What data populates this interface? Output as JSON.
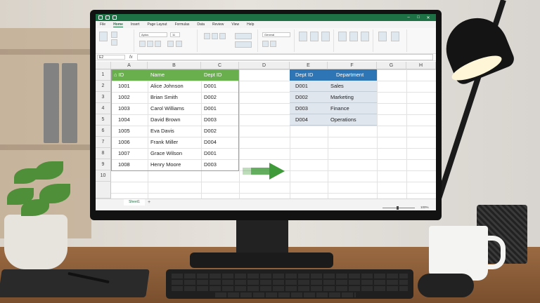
{
  "app": {
    "title": "",
    "menu": [
      "File",
      "Home",
      "Insert",
      "Page Layout",
      "Formulas",
      "Data",
      "Review",
      "View",
      "Help"
    ],
    "active_menu": "Home",
    "name_box": "E2",
    "fx": "fx",
    "font_name": "Aptos",
    "font_size": "11",
    "number_format": "General",
    "sheet_tab": "Sheet1",
    "zoom": "100%"
  },
  "columns": [
    "A",
    "B",
    "C",
    "D",
    "E",
    "F",
    "G",
    "H"
  ],
  "rows": [
    "1",
    "2",
    "3",
    "4",
    "5",
    "6",
    "7",
    "8",
    "9",
    "10"
  ],
  "employees": {
    "headers": [
      "ID",
      "Name",
      "Dept ID"
    ],
    "rows": [
      [
        "1001",
        "Alice Johnson",
        "D001"
      ],
      [
        "1002",
        "Brian Smith",
        "D002"
      ],
      [
        "1003",
        "Carol Williams",
        "D001"
      ],
      [
        "1004",
        "David Brown",
        "D003"
      ],
      [
        "1005",
        "Eva Davis",
        "D002"
      ],
      [
        "1006",
        "Frank Miller",
        "D004"
      ],
      [
        "1007",
        "Grace Wilson",
        "D001"
      ],
      [
        "1008",
        "Henry Moore",
        "D003"
      ]
    ]
  },
  "departments": {
    "headers": [
      "Dept ID",
      "Department"
    ],
    "rows": [
      [
        "D001",
        "Sales"
      ],
      [
        "D002",
        "Marketing"
      ],
      [
        "D003",
        "Finance"
      ],
      [
        "D004",
        "Operations"
      ]
    ]
  },
  "colors": {
    "excel_green": "#1e7145",
    "table1_header": "#6aaf4e",
    "table2_header": "#2e75b6",
    "table2_fill": "#dfe6ee",
    "arrow": "#3f9a3a"
  }
}
